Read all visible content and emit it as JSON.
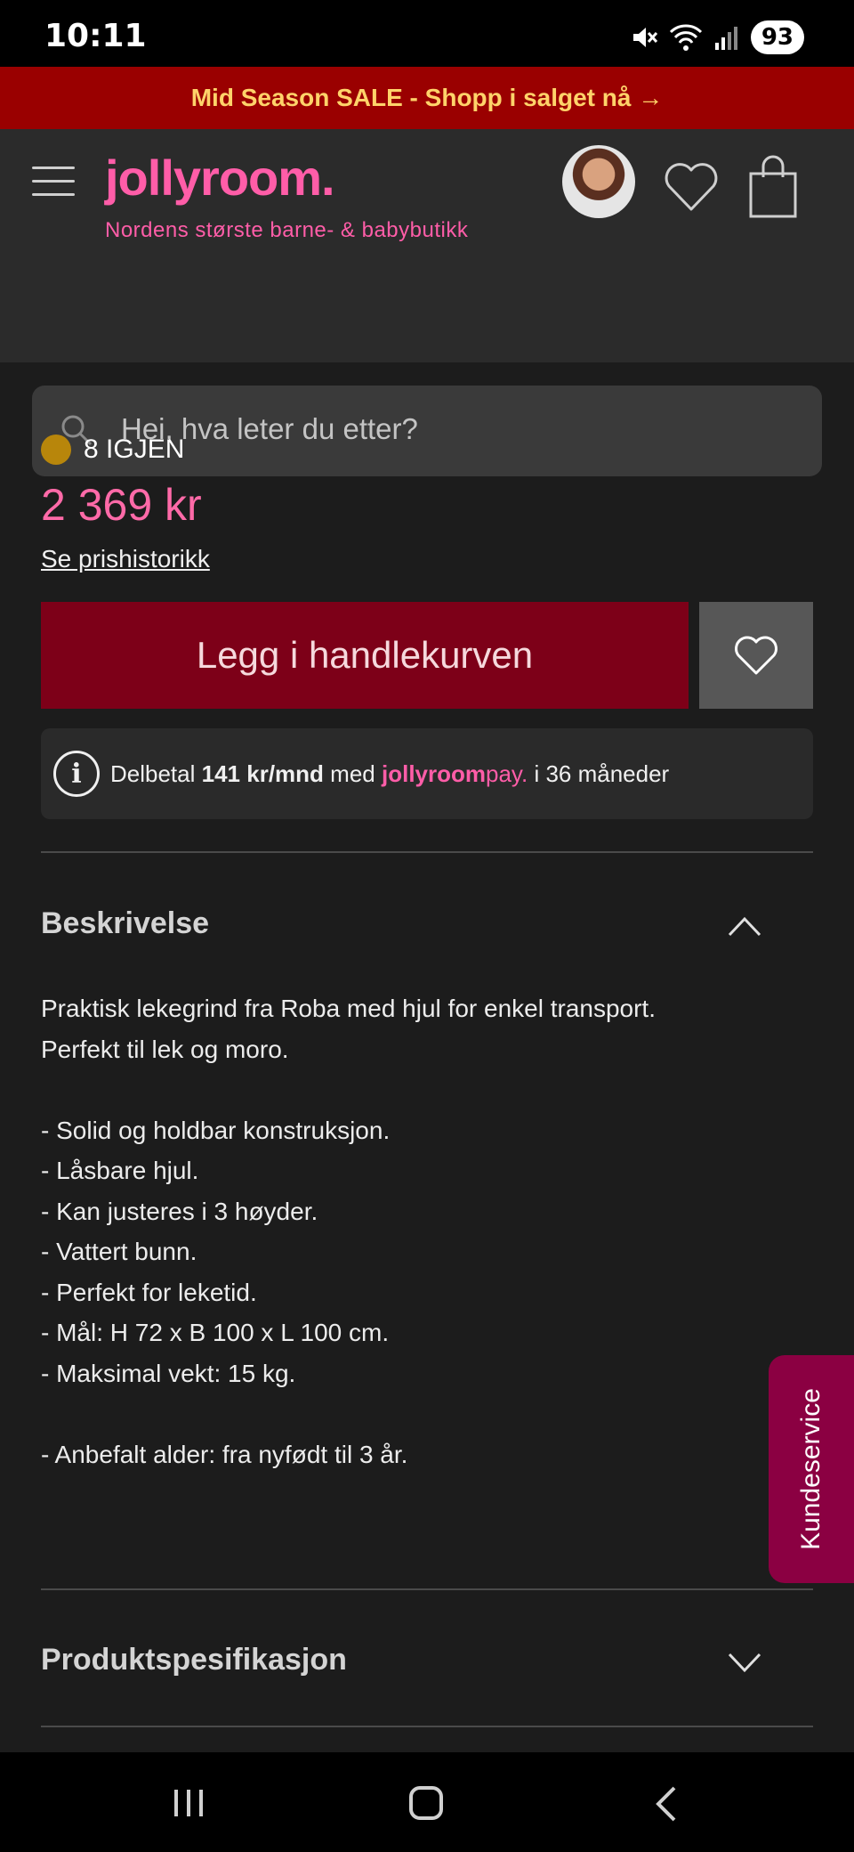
{
  "status_bar": {
    "time": "10:11",
    "battery": "93"
  },
  "promo": {
    "text": "Mid Season SALE - Shopp i salget nå →"
  },
  "header": {
    "logo": "jollyroom.",
    "tagline": "Nordens største barne- & babybutikk",
    "search_placeholder": "Hei, hva leter du etter?"
  },
  "product": {
    "stock": "8 IGJEN",
    "stock_color": "#b8860b",
    "price": "2 369 kr",
    "price_history_link": "Se prishistorikk",
    "add_to_cart": "Legg i handlekurven",
    "installment": {
      "prefix": "Delbetal",
      "amount": "141 kr/mnd",
      "middle": "med",
      "brand_main": "jollyroom",
      "brand_suffix": "pay.",
      "suffix": "i 36 måneder"
    }
  },
  "description": {
    "title": "Beskrivelse",
    "lines": [
      "Praktisk lekegrind fra Roba med hjul for enkel transport.",
      "Perfekt til lek og moro.",
      "",
      "- Solid og holdbar konstruksjon.",
      "- Låsbare hjul.",
      "- Kan justeres i 3 høyder.",
      "- Vattert bunn.",
      "- Perfekt for leketid.",
      "- Mål: H 72 x B 100 x L 100 cm.",
      "- Maksimal vekt: 15 kg.",
      "",
      "- Anbefalt alder: fra nyfødt til 3 år."
    ]
  },
  "spec": {
    "title": "Produktspesifikasjon"
  },
  "customer_service": {
    "label": "Kundeservice"
  },
  "colors": {
    "accent_pink": "#ff5da8",
    "cart_button": "#7d0018",
    "promo_bg": "#9a0000",
    "promo_text": "#ffd36a"
  }
}
